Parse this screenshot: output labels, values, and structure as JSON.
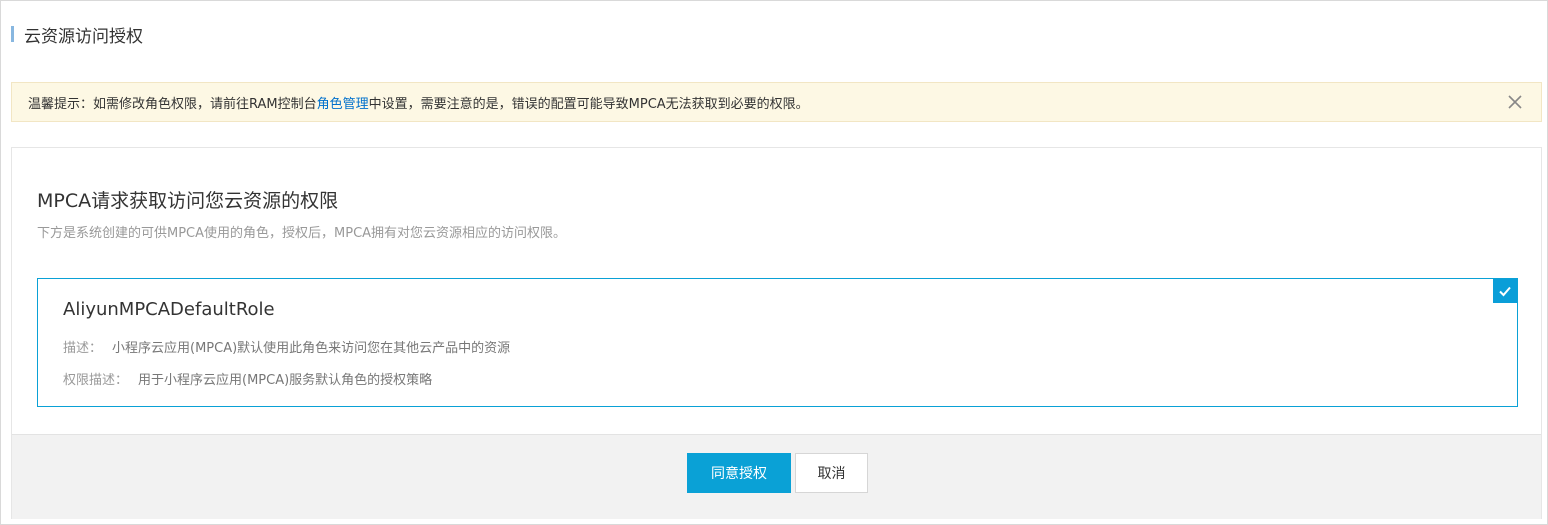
{
  "page": {
    "title": "云资源访问授权"
  },
  "notice": {
    "text_before": "温馨提示：如需修改角色权限，请前往RAM控制台",
    "link_text": "角色管理",
    "text_after": "中设置，需要注意的是，错误的配置可能导致MPCA无法获取到必要的权限。",
    "close_icon": "close-icon"
  },
  "panel": {
    "heading": "MPCA请求获取访问您云资源的权限",
    "subtitle": "下方是系统创建的可供MPCA使用的角色，授权后，MPCA拥有对您云资源相应的访问权限。"
  },
  "role": {
    "name": "AliyunMPCADefaultRole",
    "desc_label": "描述：",
    "desc_value": "小程序云应用(MPCA)默认使用此角色来访问您在其他云产品中的资源",
    "perm_label": "权限描述：",
    "perm_value": "用于小程序云应用(MPCA)服务默认角色的授权策略",
    "selected": true,
    "check_icon": "checkmark-icon"
  },
  "actions": {
    "confirm_label": "同意授权",
    "cancel_label": "取消"
  },
  "colors": {
    "accent": "#0aa1d6",
    "notice_bg": "#fdf8e4",
    "link": "#0070cc"
  }
}
